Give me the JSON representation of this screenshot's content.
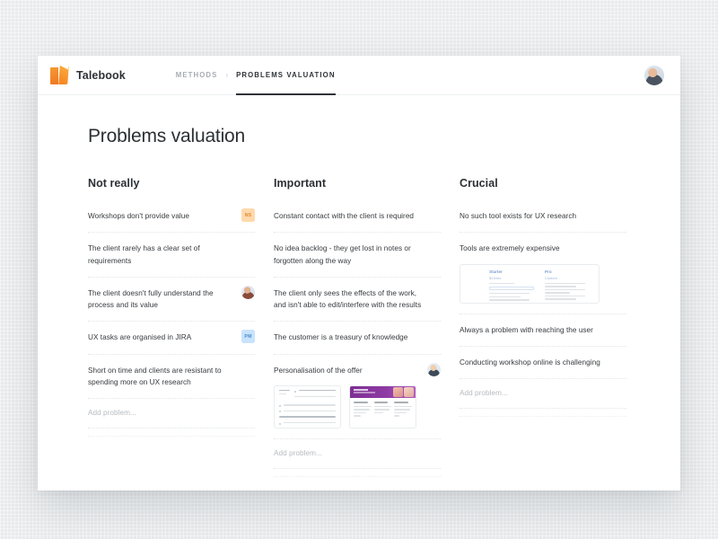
{
  "header": {
    "brand_name": "Talebook",
    "logo_icon": "talebook-book-logo",
    "breadcrumb": [
      {
        "label": "METHODS",
        "active": false
      },
      {
        "label": "PROBLEMS VALUATION",
        "active": true
      }
    ],
    "separator": "›",
    "avatar_icon": "user-avatar-photo"
  },
  "page": {
    "title": "Problems valuation",
    "add_placeholder": "Add problem..."
  },
  "colors": {
    "brand_orange": "#f58220",
    "tag_orange_bg": "#ffd9ad",
    "tag_orange_fg": "#e08a2e",
    "tag_blue_bg": "#c9e3fb",
    "tag_blue_fg": "#4a8dd0",
    "page_bg": "#e9ebed",
    "card_bg": "#ffffff",
    "text_primary": "#2b3034",
    "text_body": "#35393d",
    "text_muted": "#b6bbc0",
    "crumb_muted": "#a7adb3",
    "purple_hero": "#8e3aa4"
  },
  "columns": [
    {
      "title": "Not really",
      "items": [
        {
          "text": "Workshops don't provide value",
          "tag": {
            "type": "initials",
            "label": "NS",
            "style": "orange"
          }
        },
        {
          "text": "The client rarely has a clear set of requirements",
          "tag": null
        },
        {
          "text": "The client doesn't fully understand the process and its value",
          "tag": {
            "type": "photo",
            "label": "",
            "style": "photo"
          }
        },
        {
          "text": "UX tasks are organised in JIRA",
          "tag": {
            "type": "initials",
            "label": "PM",
            "style": "blue"
          }
        },
        {
          "text": "Short on time and clients are resistant to spending more on UX research",
          "tag": null
        }
      ]
    },
    {
      "title": "Important",
      "items": [
        {
          "text": "Constant contact with the client is required",
          "tag": null
        },
        {
          "text": "No idea backlog - they get lost in notes or forgotten along the way",
          "tag": null
        },
        {
          "text": "The client only sees the effects of the work, and isn't able to edit/interfere with the results",
          "tag": null
        },
        {
          "text": "The customer is a treasury of knowledge",
          "tag": null
        },
        {
          "text": "Personalisation of the offer",
          "tag": {
            "type": "photo",
            "label": "",
            "style": "photo2"
          },
          "thumbnails": [
            {
              "kind": "document",
              "name": "document-thumbnail"
            },
            {
              "kind": "website",
              "name": "website-thumbnail"
            }
          ]
        }
      ]
    },
    {
      "title": "Crucial",
      "items": [
        {
          "text": "No such tool exists for UX research",
          "tag": null
        },
        {
          "text": "Tools are extremely expensive",
          "tag": null,
          "thumbnails": [
            {
              "kind": "pricing",
              "name": "pricing-table-thumbnail",
              "plans": [
                {
                  "name": "Starter",
                  "price": "$19/mo"
                },
                {
                  "name": "Pro",
                  "price": "Custom"
                }
              ]
            }
          ]
        },
        {
          "text": "Always a problem with reaching the user",
          "tag": null
        },
        {
          "text": "Conducting workshop online is challenging",
          "tag": null
        }
      ]
    }
  ]
}
